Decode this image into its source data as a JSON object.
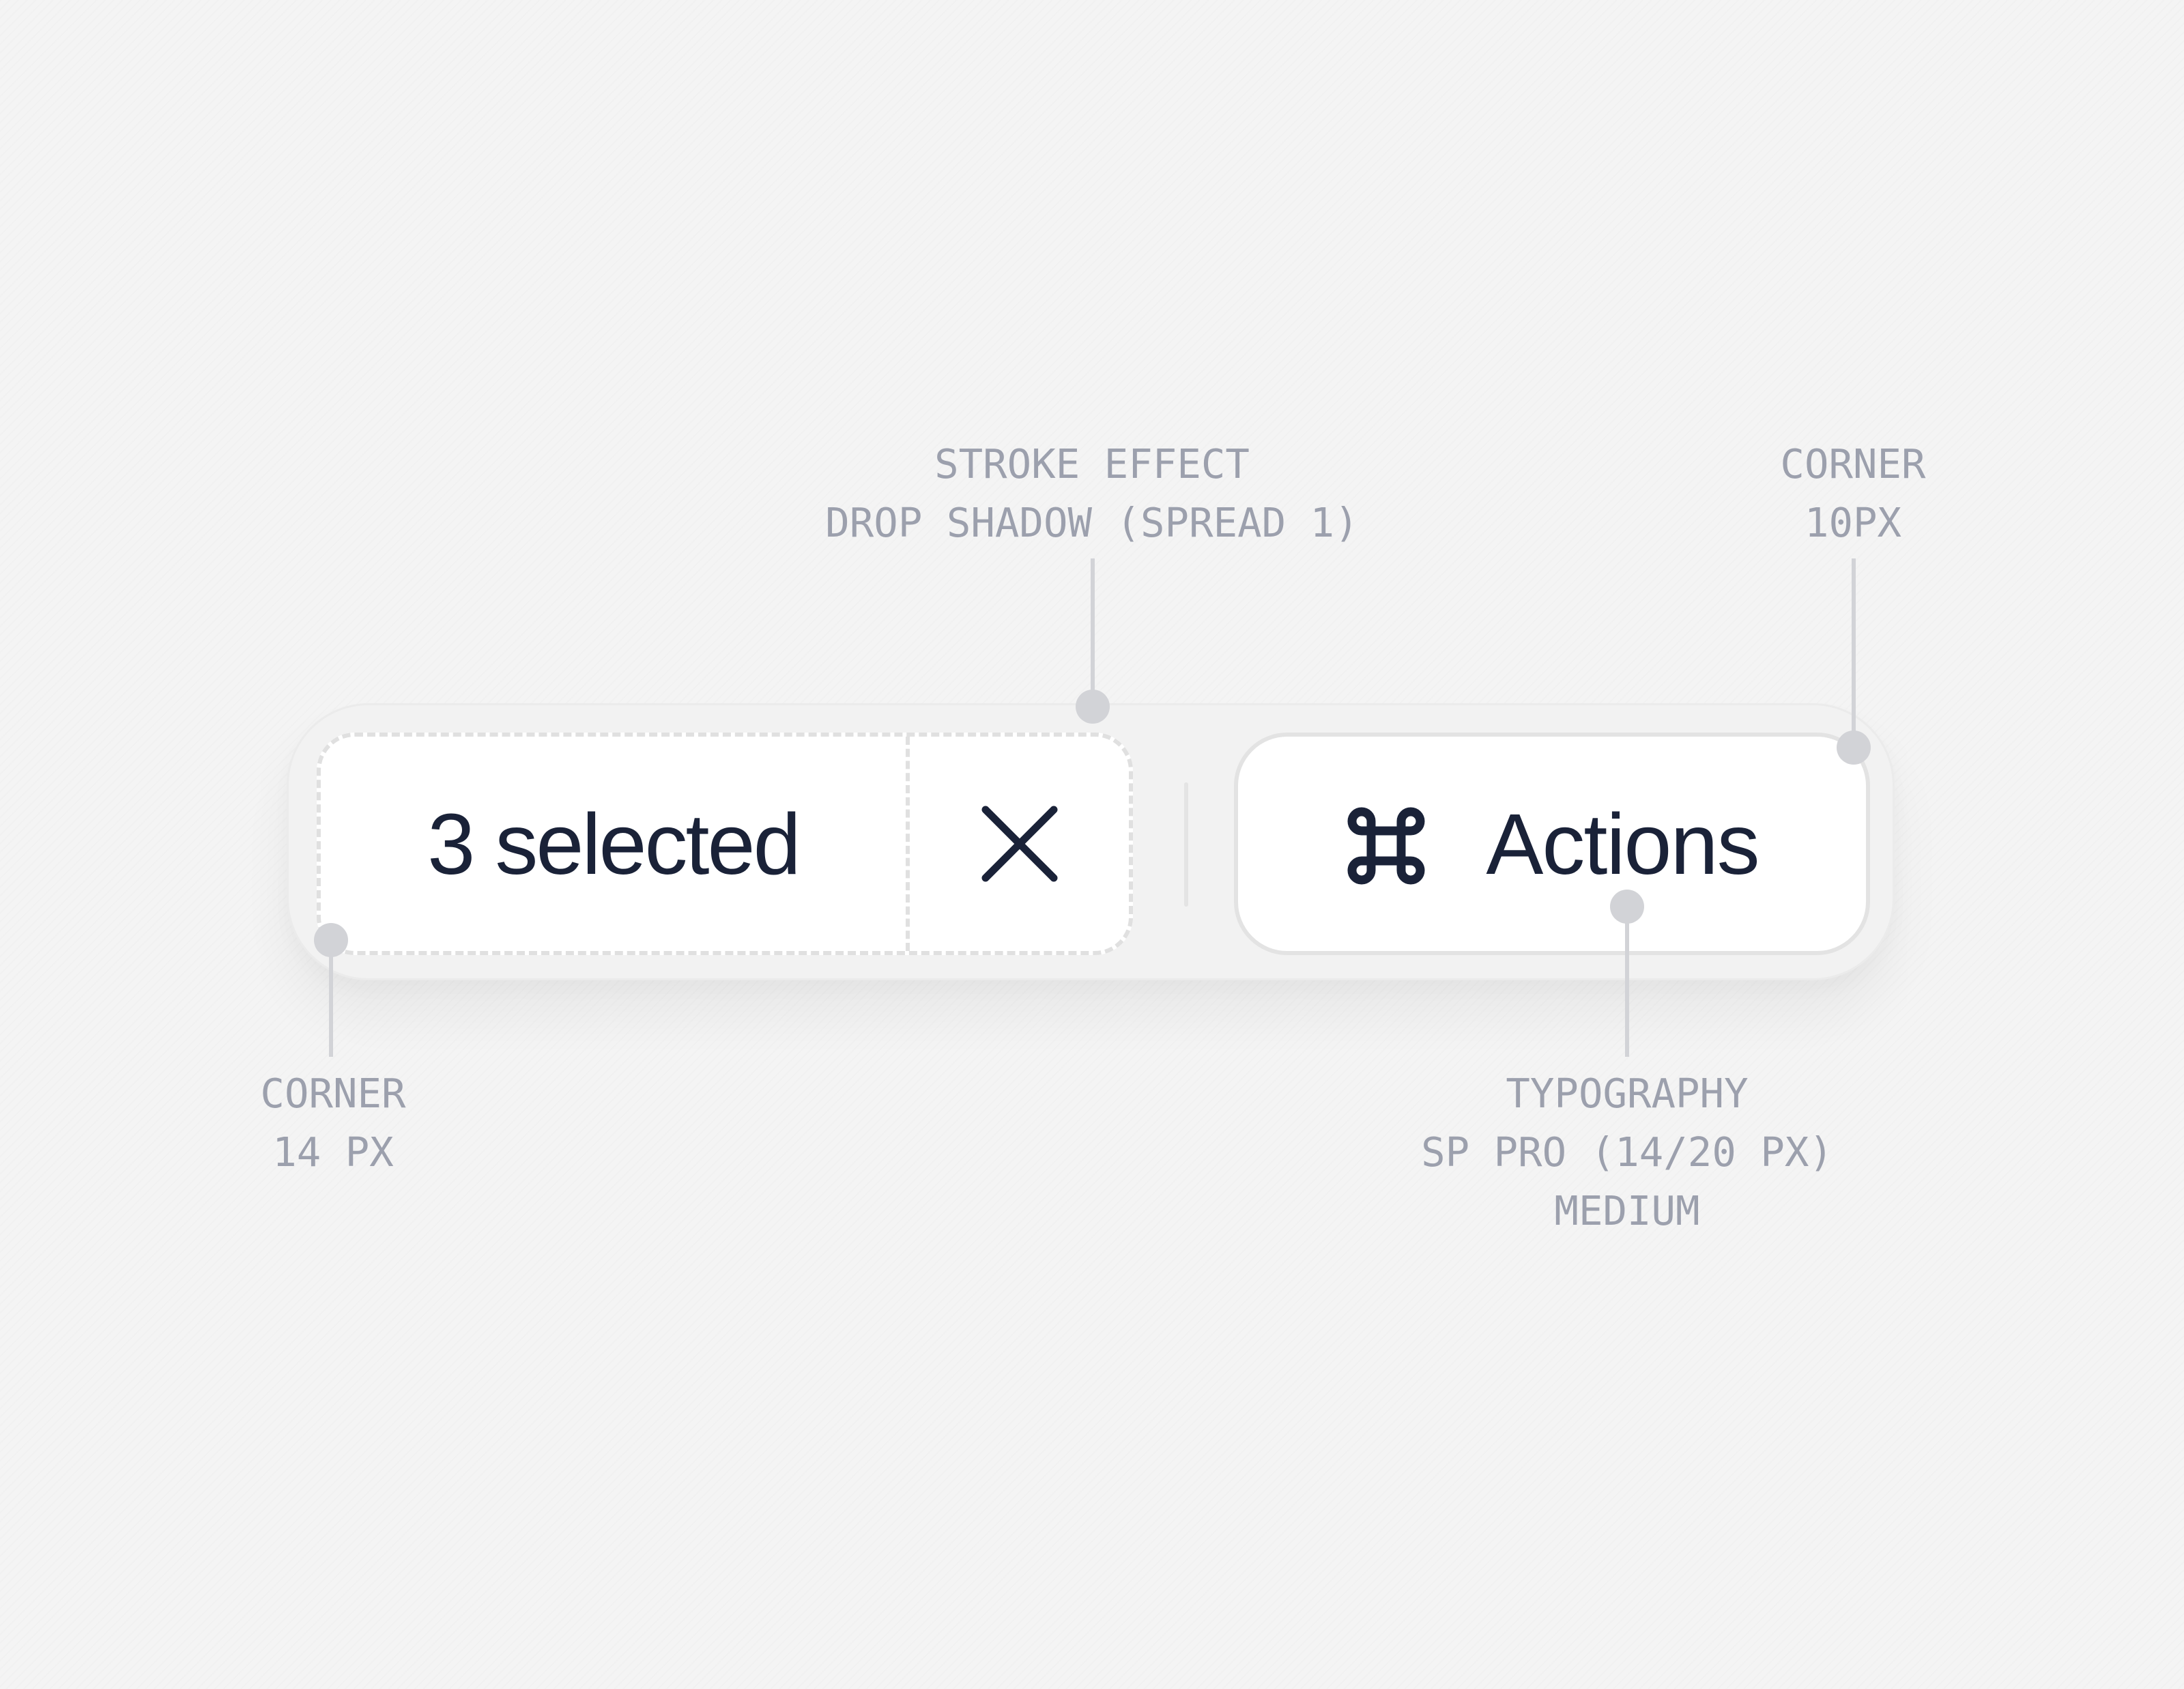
{
  "toolbar": {
    "selected_label": "3 selected",
    "actions_label": "Actions"
  },
  "icons": {
    "clear": "close-icon",
    "command": "command-key-icon"
  },
  "annotations": {
    "stroke": {
      "line1": "STROKE EFFECT",
      "line2": "DROP SHADOW (SPREAD 1)"
    },
    "corner_outer": {
      "line1": "CORNER",
      "line2": "10PX"
    },
    "corner_inner": {
      "line1": "CORNER",
      "line2": "14 PX"
    },
    "typography": {
      "line1": "TYPOGRAPHY",
      "line2": "SP PRO (14/20 PX)",
      "line3": "MEDIUM"
    }
  },
  "colors": {
    "background": "#f4f4f4",
    "text": "#1a2238",
    "annotation": "#9ca0ad",
    "leader": "#d2d3d7",
    "border": "#e3e3e3"
  }
}
